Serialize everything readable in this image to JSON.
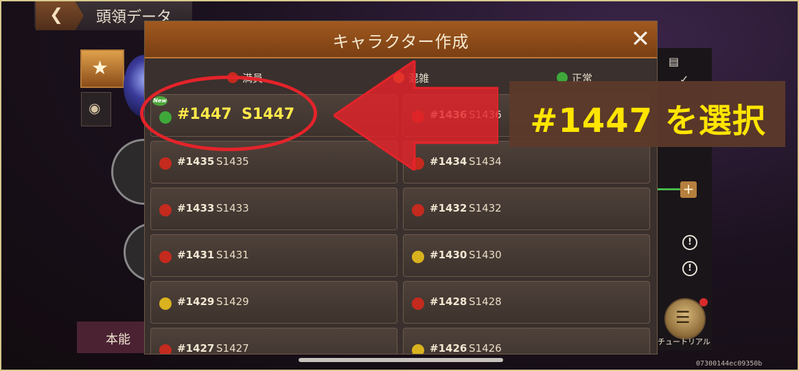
{
  "screen": {
    "title": "頭領データ",
    "instinct_tab": "本能",
    "tutorial_label": "チュートリアル",
    "version_code": "07300144ec09350b"
  },
  "modal": {
    "title": "キャラクター作成",
    "close_icon": "close-icon",
    "legend": [
      {
        "label": "満員",
        "color": "#c42a1e"
      },
      {
        "label": "混雑",
        "color": "#e2782a"
      },
      {
        "label": "正常",
        "color": "#3ea83a"
      }
    ],
    "servers": [
      {
        "id": "#1447",
        "name": "S1447",
        "status_color": "#3ea83a",
        "new": true,
        "new_label": "New",
        "selected": true
      },
      {
        "id": "#1436",
        "name": "S1436",
        "status_color": "#c42a1e"
      },
      {
        "id": "#1435",
        "name": "S1435",
        "status_color": "#c42a1e"
      },
      {
        "id": "#1434",
        "name": "S1434",
        "status_color": "#c42a1e"
      },
      {
        "id": "#1433",
        "name": "S1433",
        "status_color": "#c42a1e"
      },
      {
        "id": "#1432",
        "name": "S1432",
        "status_color": "#c42a1e"
      },
      {
        "id": "#1431",
        "name": "S1431",
        "status_color": "#c42a1e"
      },
      {
        "id": "#1430",
        "name": "S1430",
        "status_color": "#d9b21e"
      },
      {
        "id": "#1429",
        "name": "S1429",
        "status_color": "#d9b21e"
      },
      {
        "id": "#1428",
        "name": "S1428",
        "status_color": "#c42a1e"
      },
      {
        "id": "#1427",
        "name": "S1427",
        "status_color": "#c42a1e"
      },
      {
        "id": "#1426",
        "name": "S1426",
        "status_color": "#d9b21e"
      }
    ]
  },
  "annotation": {
    "callout_text": "#1447 を選択",
    "color": "#e4232a"
  }
}
